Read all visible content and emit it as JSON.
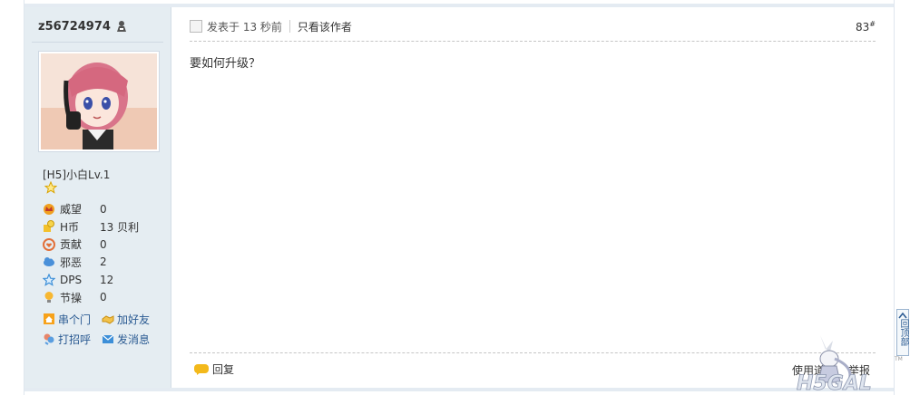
{
  "user": {
    "username": "z56724974",
    "rank": "[H5]小白Lv.1",
    "stats": [
      {
        "label": "威望",
        "value": "0",
        "icon": "crown-icon"
      },
      {
        "label": "H币",
        "value": "13 贝利",
        "icon": "coin-icon"
      },
      {
        "label": "贡献",
        "value": "0",
        "icon": "heart-icon"
      },
      {
        "label": "邪恶",
        "value": "2",
        "icon": "cloud-icon"
      },
      {
        "label": "DPS",
        "value": "12",
        "icon": "star-outline-icon"
      },
      {
        "label": "节操",
        "value": "0",
        "icon": "bulb-icon"
      }
    ],
    "actions": [
      {
        "label": "串个门",
        "icon": "home-icon"
      },
      {
        "label": "加好友",
        "icon": "handshake-icon"
      },
      {
        "label": "打招呼",
        "icon": "wave-icon"
      },
      {
        "label": "发消息",
        "icon": "mail-icon"
      }
    ]
  },
  "post": {
    "time": "发表于 13 秒前",
    "only_author": "只看该作者",
    "floor": "83",
    "floor_mark": "#",
    "body": "要如何升级？",
    "reply_label": "回复",
    "tools": [
      "使用道具",
      "举报"
    ]
  },
  "watermark": {
    "tm": "TM"
  },
  "back_top": {
    "label": "回顶部"
  },
  "colors": {
    "sidebar_bg": "#e5edf2",
    "link": "#2a5a92",
    "border": "#dfe6ee"
  }
}
